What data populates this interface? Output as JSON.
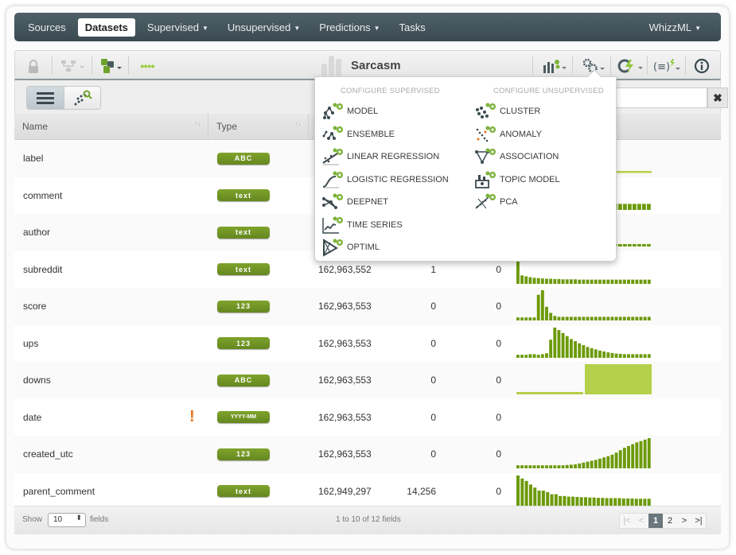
{
  "nav": {
    "items": [
      {
        "label": "Sources",
        "active": false,
        "caret": false
      },
      {
        "label": "Datasets",
        "active": true,
        "caret": false
      },
      {
        "label": "Supervised",
        "active": false,
        "caret": true
      },
      {
        "label": "Unsupervised",
        "active": false,
        "caret": true
      },
      {
        "label": "Predictions",
        "active": false,
        "caret": true
      },
      {
        "label": "Tasks",
        "active": false,
        "caret": false
      }
    ],
    "right": "WhizzML",
    "caret_glyph": "▼"
  },
  "toolbar": {
    "title": "Sarcasm",
    "status_dots": "●●●●",
    "accent_color": "#8dc63f"
  },
  "search": {
    "value": "",
    "clear_glyph": "✖"
  },
  "dropdown": {
    "supervised_heading": "CONFIGURE SUPERVISED",
    "unsupervised_heading": "CONFIGURE UNSUPERVISED",
    "supervised": [
      {
        "label": "MODEL",
        "icon": "model-icon"
      },
      {
        "label": "ENSEMBLE",
        "icon": "ensemble-icon"
      },
      {
        "label": "LINEAR REGRESSION",
        "icon": "linear-regression-icon"
      },
      {
        "label": "LOGISTIC REGRESSION",
        "icon": "logistic-regression-icon"
      },
      {
        "label": "DEEPNET",
        "icon": "deepnet-icon"
      },
      {
        "label": "TIME SERIES",
        "icon": "time-series-icon"
      },
      {
        "label": "OPTIML",
        "icon": "optiml-icon"
      }
    ],
    "unsupervised": [
      {
        "label": "CLUSTER",
        "icon": "cluster-icon"
      },
      {
        "label": "ANOMALY",
        "icon": "anomaly-icon"
      },
      {
        "label": "ASSOCIATION",
        "icon": "association-icon"
      },
      {
        "label": "TOPIC MODEL",
        "icon": "topic-model-icon"
      },
      {
        "label": "PCA",
        "icon": "pca-icon"
      }
    ]
  },
  "table": {
    "headers": {
      "name": "Name",
      "type": "Type"
    },
    "sort_glyph": "↑↓",
    "rows": [
      {
        "name": "label",
        "type": "ABC",
        "count": "",
        "missing": "",
        "errors": "",
        "warn": false,
        "hist": [
          0.05
        ],
        "hist_style": "flat"
      },
      {
        "name": "comment",
        "type": "text",
        "count": "",
        "missing": "",
        "errors": "",
        "warn": false,
        "hist": [
          0.2,
          0.2,
          0.2,
          0.2,
          0.2,
          0.2,
          0.2,
          0.2
        ],
        "hist_style": "tail"
      },
      {
        "name": "author",
        "type": "text",
        "count": "",
        "missing": "",
        "errors": "",
        "warn": false,
        "hist": [
          0.08,
          0.08,
          0.08,
          0.08,
          0.08,
          0.08,
          0.08,
          0.08
        ],
        "hist_style": "tail"
      },
      {
        "name": "subreddit",
        "type": "text",
        "count": "162,963,552",
        "missing": "1",
        "errors": "0",
        "warn": false,
        "hist": [
          1,
          0.28,
          0.25,
          0.22,
          0.2,
          0.19,
          0.18,
          0.17,
          0.17,
          0.16,
          0.16,
          0.15,
          0.15,
          0.15,
          0.15,
          0.14,
          0.14,
          0.14,
          0.14,
          0.14,
          0.14,
          0.14,
          0.14,
          0.14,
          0.14,
          0.14,
          0.14,
          0.14,
          0.14,
          0.14,
          0.14,
          0.14,
          0.14
        ],
        "hist_style": "bars"
      },
      {
        "name": "score",
        "type": "123",
        "count": "162,963,553",
        "missing": "0",
        "errors": "0",
        "warn": false,
        "hist": [
          0.1,
          0.1,
          0.1,
          0.1,
          0.1,
          0.85,
          1,
          0.45,
          0.25,
          0.15,
          0.12,
          0.12,
          0.12,
          0.12,
          0.12,
          0.12,
          0.12,
          0.12,
          0.12,
          0.12,
          0.12,
          0.12,
          0.12,
          0.12,
          0.12,
          0.12,
          0.12,
          0.12,
          0.12,
          0.12,
          0.12,
          0.12,
          0.12
        ],
        "hist_style": "bars"
      },
      {
        "name": "ups",
        "type": "123",
        "count": "162,963,553",
        "missing": "0",
        "errors": "0",
        "warn": false,
        "hist": [
          0.1,
          0.1,
          0.1,
          0.12,
          0.12,
          0.1,
          0.12,
          0.15,
          0.6,
          1,
          0.92,
          0.82,
          0.72,
          0.62,
          0.55,
          0.48,
          0.42,
          0.36,
          0.32,
          0.28,
          0.24,
          0.21,
          0.18,
          0.16,
          0.14,
          0.13,
          0.12,
          0.12,
          0.12,
          0.12,
          0.12,
          0.12,
          0.12
        ],
        "hist_style": "bars"
      },
      {
        "name": "downs",
        "type": "ABC",
        "count": "162,963,553",
        "missing": "0",
        "errors": "0",
        "warn": false,
        "hist": [
          0.08,
          1
        ],
        "hist_style": "blocks"
      },
      {
        "name": "date",
        "type": "YYYY-MM",
        "count": "162,963,553",
        "missing": "0",
        "errors": "0",
        "warn": true,
        "hist": [],
        "hist_style": "none"
      },
      {
        "name": "created_utc",
        "type": "123",
        "count": "162,963,553",
        "missing": "0",
        "errors": "0",
        "warn": false,
        "hist": [
          0.1,
          0.1,
          0.1,
          0.1,
          0.1,
          0.1,
          0.1,
          0.1,
          0.1,
          0.1,
          0.1,
          0.1,
          0.11,
          0.12,
          0.13,
          0.16,
          0.19,
          0.22,
          0.25,
          0.28,
          0.32,
          0.36,
          0.4,
          0.45,
          0.52,
          0.6,
          0.68,
          0.74,
          0.8,
          0.86,
          0.9,
          0.95,
          1
        ],
        "hist_style": "bars"
      },
      {
        "name": "parent_comment",
        "type": "text",
        "count": "162,949,297",
        "missing": "14,256",
        "errors": "0",
        "warn": false,
        "hist": [
          1,
          0.9,
          0.82,
          0.7,
          0.6,
          0.5,
          0.5,
          0.45,
          0.38,
          0.38,
          0.32,
          0.32,
          0.3,
          0.3,
          0.29,
          0.28,
          0.28,
          0.27,
          0.27,
          0.26,
          0.26,
          0.25,
          0.25,
          0.25,
          0.25,
          0.24,
          0.24,
          0.24,
          0.23,
          0.23,
          0.23,
          0.23
        ],
        "hist_style": "bars"
      }
    ]
  },
  "footer": {
    "show_label": "Show",
    "page_size": "10",
    "fields_label": "fields",
    "info": "1 to 10 of 12 fields",
    "pager": {
      "first": "|<",
      "prev": "<",
      "pages": [
        "1",
        "2"
      ],
      "current": "1",
      "next": ">",
      "last": ">|"
    }
  },
  "colors": {
    "bar_dark": "#6c9a0a",
    "bar_light": "#b5d04a",
    "type_badge": "#74982a",
    "warn": "#e8731b",
    "nav_bg": "#45555c"
  }
}
